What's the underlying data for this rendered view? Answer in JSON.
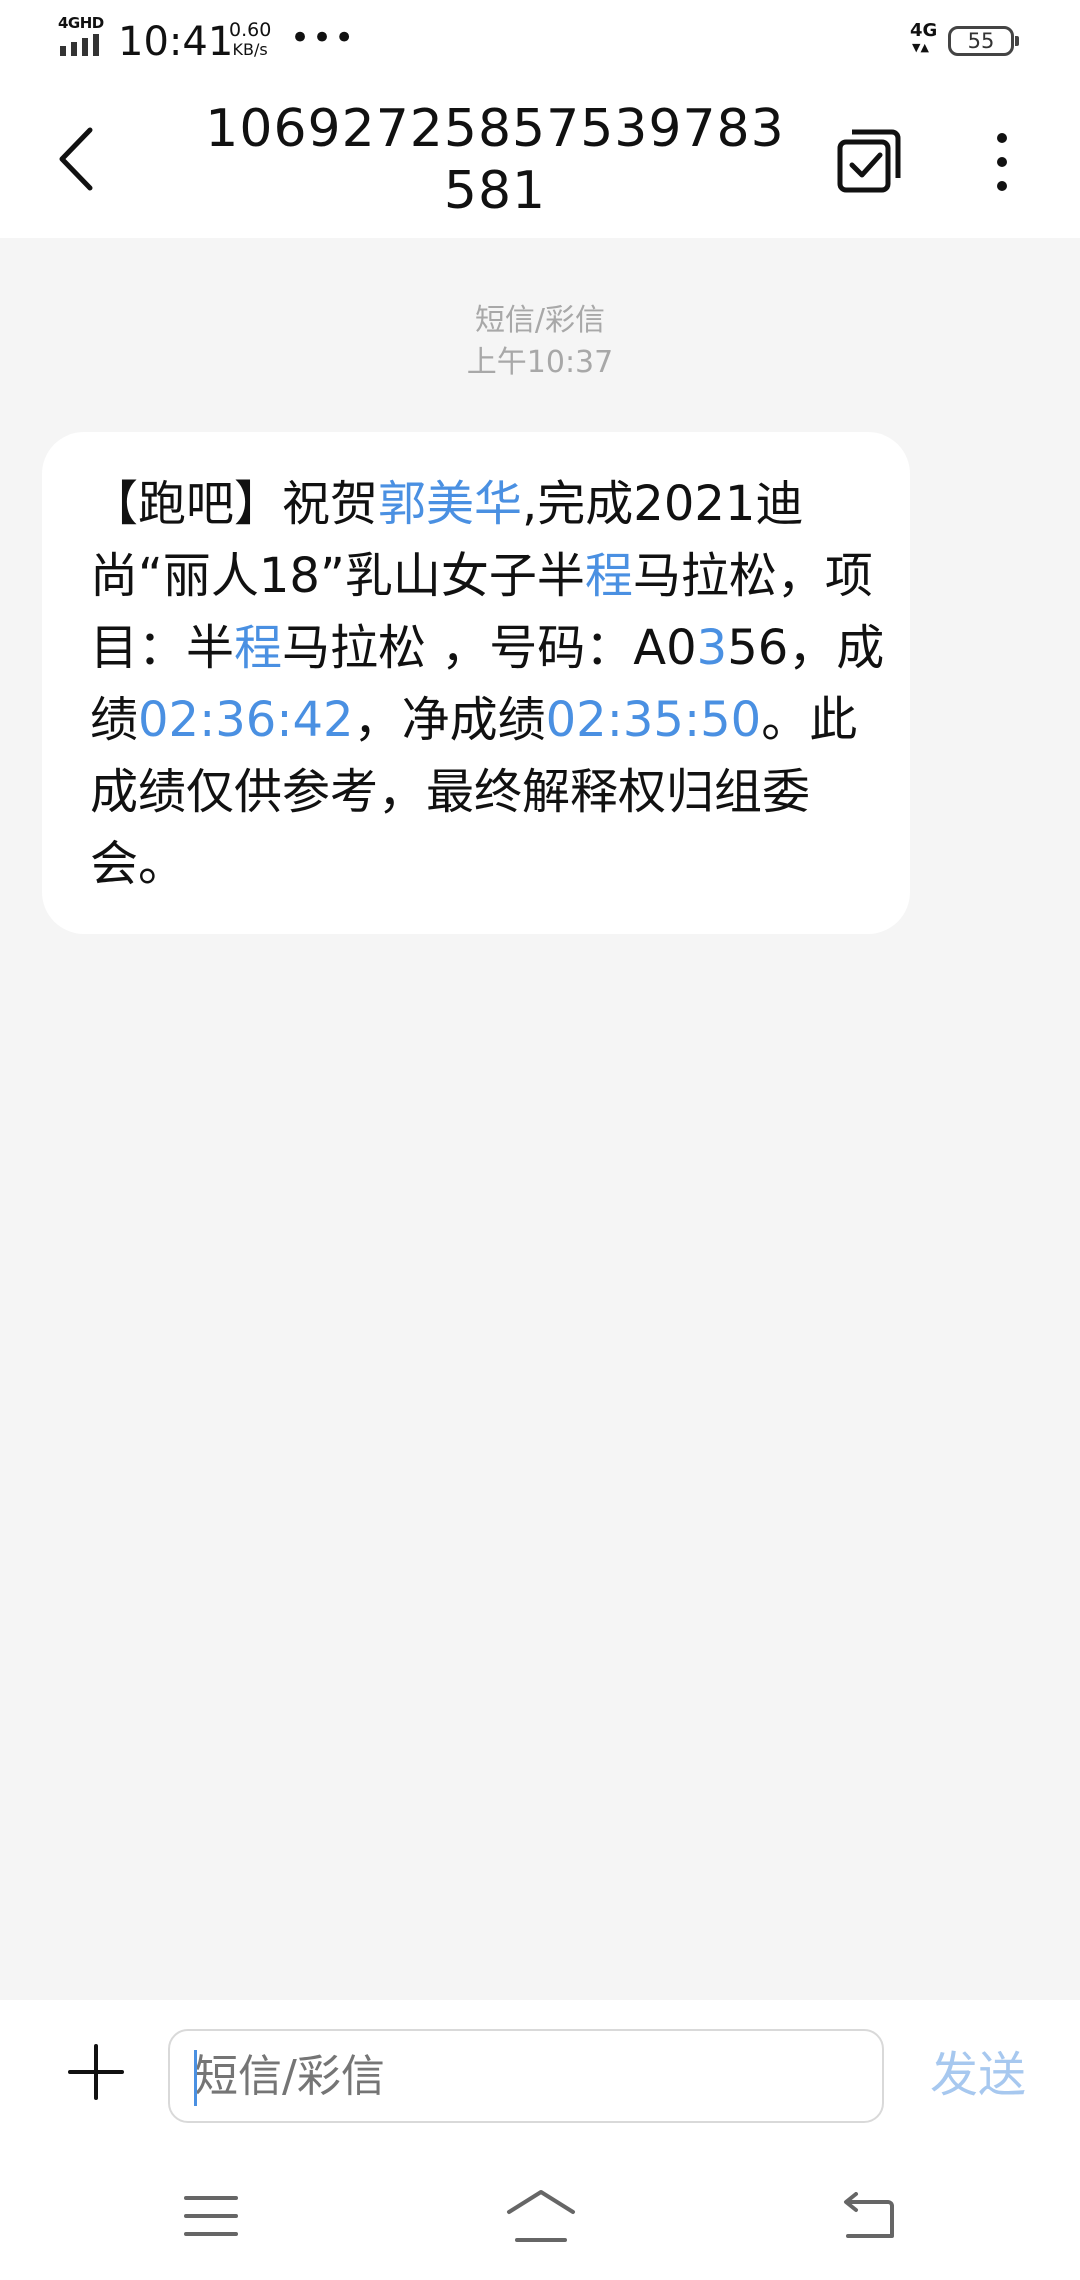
{
  "status_bar": {
    "network_top": "4GHD",
    "time": "10:41",
    "speed_value": "0.60",
    "speed_unit": "KB/s",
    "more": "•••",
    "cell": "4G",
    "battery": "55"
  },
  "header": {
    "title": "10692725857539783581",
    "back_icon": "chevron-left-icon",
    "select_icon": "multi-select-icon",
    "more_icon": "vertical-dots-icon"
  },
  "conversation": {
    "type_label": "短信/彩信",
    "timestamp": "上午10:37",
    "message": {
      "segments": [
        {
          "text": "【跑吧】祝贺",
          "highlight": false
        },
        {
          "text": "郭美华",
          "highlight": true
        },
        {
          "text": ",完成2021迪尚“丽人18”乳山女子半",
          "highlight": false
        },
        {
          "text": "程",
          "highlight": true
        },
        {
          "text": "马拉松，项目：半",
          "highlight": false
        },
        {
          "text": "程",
          "highlight": true
        },
        {
          "text": "马拉松 ，号码：A0",
          "highlight": false
        },
        {
          "text": "3",
          "highlight": true
        },
        {
          "text": "56，成绩",
          "highlight": false
        },
        {
          "text": "02:36:42",
          "highlight": true
        },
        {
          "text": "，净成绩",
          "highlight": false
        },
        {
          "text": "02:35:50",
          "highlight": true
        },
        {
          "text": "。此成绩仅供参考，最终解释权归组委会。",
          "highlight": false
        }
      ]
    }
  },
  "composer": {
    "placeholder": "短信/彩信",
    "send_label": "发送",
    "add_icon": "plus-icon"
  },
  "navigation": {
    "menu_icon": "menu-icon",
    "home_icon": "home-icon",
    "back_icon": "back-icon"
  },
  "colors": {
    "highlight": "#4a90e2",
    "send_disabled": "#a7c8ef",
    "background": "#f5f5f5"
  }
}
